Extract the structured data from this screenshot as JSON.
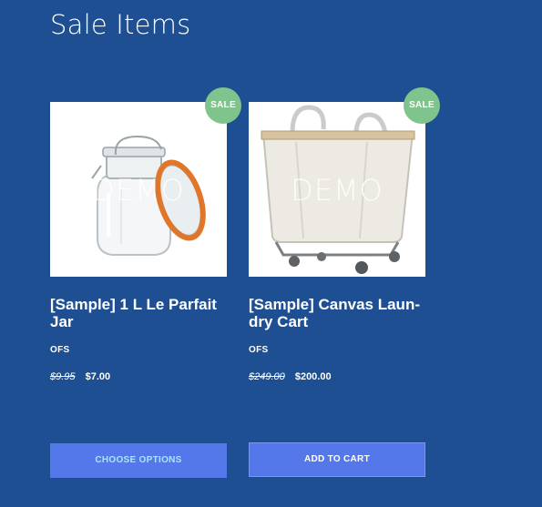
{
  "section": {
    "title": "Sale Items"
  },
  "products": [
    {
      "name": "[Sample] 1 L Le Parfait Jar",
      "brand": "OFS",
      "price_old": "$9.95",
      "price_new": "$7.00",
      "badge": "SALE",
      "watermark": "DEMO",
      "image_icon": "glass-jar-icon",
      "button": "CHOOSE OPTIONS"
    },
    {
      "name": "[Sample] Canvas Laun- dry Cart",
      "brand": "OFS",
      "price_old": "$249.00",
      "price_new": "$200.00",
      "badge": "SALE",
      "watermark": "DEMO",
      "image_icon": "laundry-cart-icon",
      "button": "ADD TO CART"
    }
  ],
  "colors": {
    "background": "#1d4f92",
    "badge": "#80c48d",
    "button": "#5477ea",
    "choose_label": "#a7e7f4"
  }
}
